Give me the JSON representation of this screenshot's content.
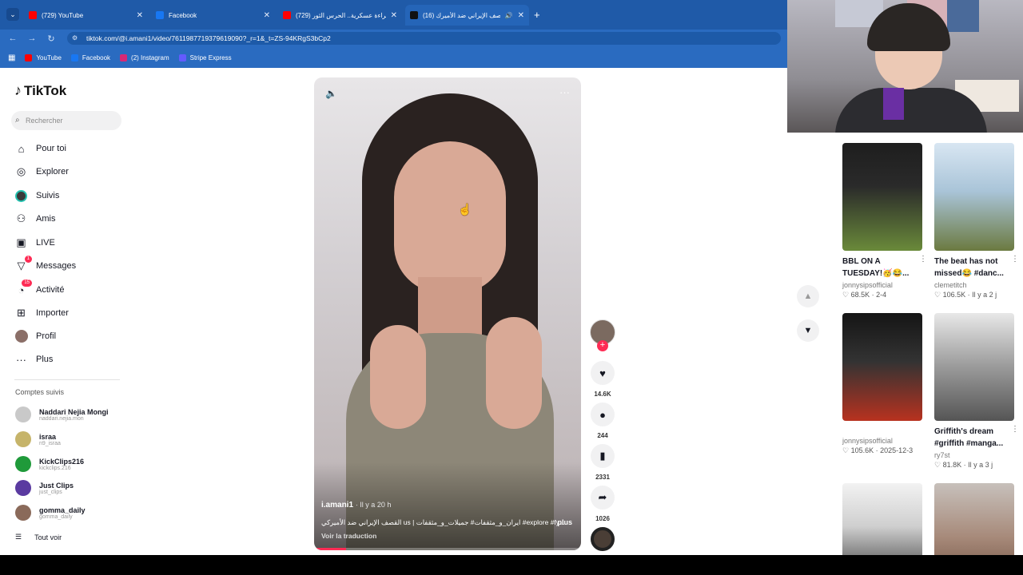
{
  "browser": {
    "tabs": [
      {
        "title": "(729) YouTube",
        "color": "#ff0000"
      },
      {
        "title": "Facebook",
        "color": "#1877f2"
      },
      {
        "title": "(729) قراءة عسكرية.. الحرس الثور",
        "color": "#ff0000"
      },
      {
        "title": "(16) القصف الإيراني ضد الأميرك",
        "color": "#111111"
      }
    ],
    "new_tab": "+",
    "url": "tiktok.com/@i.amani1/video/7611987719379619090?_r=1&_t=ZS-94KRgS3bCp2",
    "bookmarks": [
      {
        "label": "YouTube",
        "color": "#ff0000"
      },
      {
        "label": "Facebook",
        "color": "#1877f2"
      },
      {
        "label": "(2) Instagram",
        "color": "#d62976"
      },
      {
        "label": "Stripe Express",
        "color": "#635bff"
      }
    ]
  },
  "sidebar": {
    "logo": "TikTok",
    "search_placeholder": "Rechercher",
    "nav": [
      {
        "label": "Pour toi",
        "icon": "home-icon"
      },
      {
        "label": "Explorer",
        "icon": "compass-icon"
      },
      {
        "label": "Suivis",
        "icon": "following-avatar-icon"
      },
      {
        "label": "Amis",
        "icon": "friends-icon"
      },
      {
        "label": "LIVE",
        "icon": "live-icon"
      },
      {
        "label": "Messages",
        "icon": "messages-icon",
        "badge": "1"
      },
      {
        "label": "Activité",
        "icon": "activity-icon",
        "badge": "15"
      },
      {
        "label": "Importer",
        "icon": "upload-icon"
      },
      {
        "label": "Profil",
        "icon": "profile-avatar-icon"
      },
      {
        "label": "Plus",
        "icon": "more-icon"
      }
    ],
    "followed_title": "Comptes suivis",
    "followed": [
      {
        "name": "Naddari Nejia Mongi",
        "handle": "naddari.nejia.mon",
        "color": "#c9c9c9"
      },
      {
        "name": "israa",
        "handle": "n9_israa",
        "color": "#c6b46a"
      },
      {
        "name": "KickClips216",
        "handle": "kickclips.216",
        "color": "#1f9a3a"
      },
      {
        "name": "Just Clips",
        "handle": "just_clips",
        "color": "#5a3aa0"
      },
      {
        "name": "gomma_daily",
        "handle": "gomma_daily",
        "color": "#8a6a5a"
      }
    ],
    "see_all": "Tout voir"
  },
  "video": {
    "username": "i.amani1",
    "time": "· Il y a 20 h",
    "caption": "القصف الإيراني ضد الأميركي us | ايران_و_مثقفات# جميلات_و_مثقفات #explore #fy...",
    "more": "plus",
    "translate": "Voir la traduction",
    "progress": 0.12
  },
  "actions": {
    "likes": "14.6K",
    "comments": "244",
    "saves": "2331",
    "shares": "1026"
  },
  "feed": [
    {
      "title": "BBL ON A TUESDAY!🥳😂...",
      "user": "jonnysipsofficial",
      "stats": "♡ 68.5K · 2-4",
      "colors": [
        "#1e1e1e",
        "#6a8a3a"
      ]
    },
    {
      "title": "The beat has not missed😂 #danc...",
      "user": "clemetitch",
      "stats": "♡ 106.5K · Il y a 2 j",
      "colors": [
        "#d8e6f2",
        "#6b7a40"
      ]
    },
    {
      "title": "",
      "user": "jonnysipsofficial",
      "stats": "♡ 105.6K · 2025-12-3",
      "colors": [
        "#151515",
        "#b8321f"
      ]
    },
    {
      "title": "Griffith's dream #griffith #manga...",
      "user": "ry7st",
      "stats": "♡ 81.8K · Il y a 3 j",
      "colors": [
        "#e8e8e8",
        "#555555"
      ]
    },
    {
      "title": "",
      "user": "",
      "stats": "",
      "colors": [
        "#f2f2f2",
        "#222222"
      ]
    },
    {
      "title": "",
      "user": "",
      "stats": "",
      "colors": [
        "#c7c0bb",
        "#6b4a3a"
      ]
    }
  ]
}
